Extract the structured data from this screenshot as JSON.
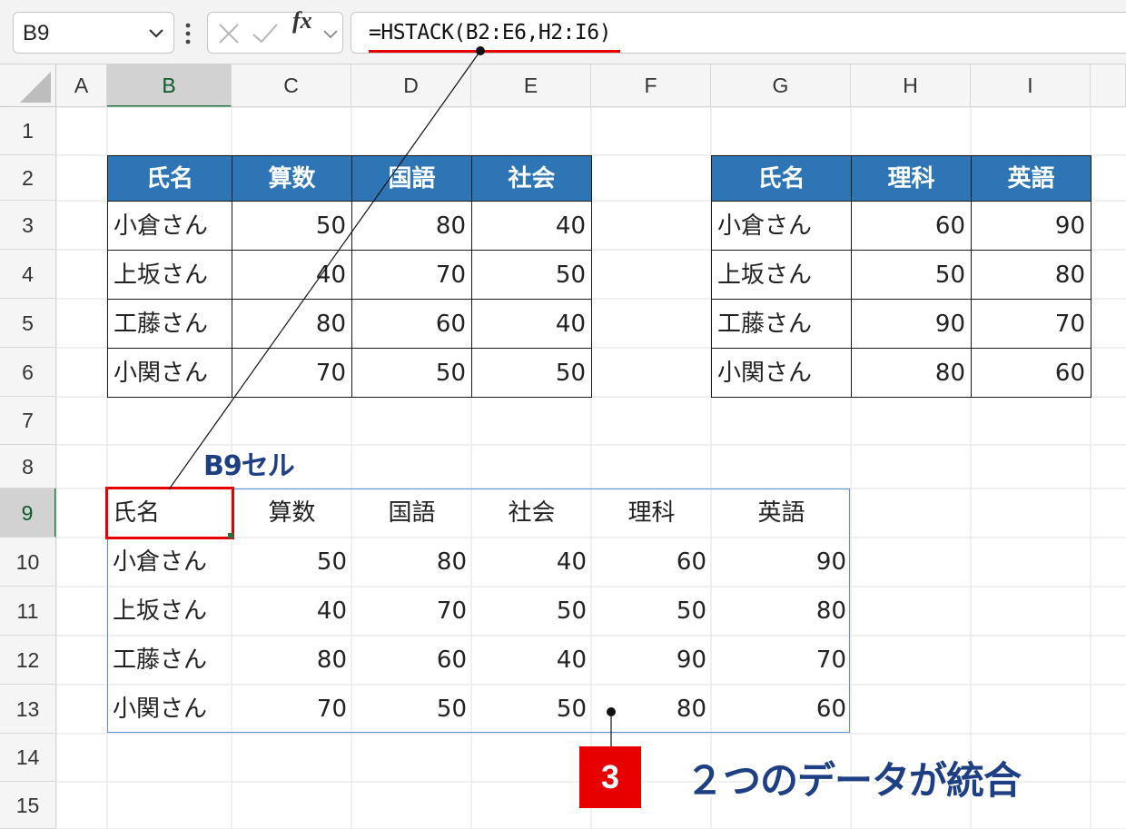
{
  "toolbar": {
    "name_box": "B9",
    "fx_label": "fx",
    "formula": "=HSTACK(B2:E6,H2:I6)"
  },
  "columns": [
    "A",
    "B",
    "C",
    "D",
    "E",
    "F",
    "G",
    "H",
    "I"
  ],
  "rows": [
    "1",
    "2",
    "3",
    "4",
    "5",
    "6",
    "7",
    "8",
    "9",
    "10",
    "11",
    "12",
    "13",
    "14",
    "15"
  ],
  "table1": {
    "headers": [
      "氏名",
      "算数",
      "国語",
      "社会"
    ],
    "rows": [
      [
        "小倉さん",
        "50",
        "80",
        "40"
      ],
      [
        "上坂さん",
        "40",
        "70",
        "50"
      ],
      [
        "工藤さん",
        "80",
        "60",
        "40"
      ],
      [
        "小関さん",
        "70",
        "50",
        "50"
      ]
    ]
  },
  "table2": {
    "headers": [
      "氏名",
      "理科",
      "英語"
    ],
    "rows": [
      [
        "小倉さん",
        "60",
        "90"
      ],
      [
        "上坂さん",
        "50",
        "80"
      ],
      [
        "工藤さん",
        "90",
        "70"
      ],
      [
        "小関さん",
        "80",
        "60"
      ]
    ]
  },
  "result": {
    "headers": [
      "氏名",
      "算数",
      "国語",
      "社会",
      "理科",
      "英語"
    ],
    "rows": [
      [
        "小倉さん",
        "50",
        "80",
        "40",
        "60",
        "90"
      ],
      [
        "上坂さん",
        "40",
        "70",
        "50",
        "50",
        "80"
      ],
      [
        "工藤さん",
        "80",
        "60",
        "40",
        "90",
        "70"
      ],
      [
        "小関さん",
        "70",
        "50",
        "50",
        "80",
        "60"
      ]
    ]
  },
  "annotations": {
    "cell_label": "B9セル",
    "step_number": "3",
    "caption": "２つのデータが統合"
  },
  "colors": {
    "header_fill": "#2e75b6",
    "accent_red": "#e60000",
    "annotation_text": "#1f3f85",
    "selection_green": "#217346"
  }
}
